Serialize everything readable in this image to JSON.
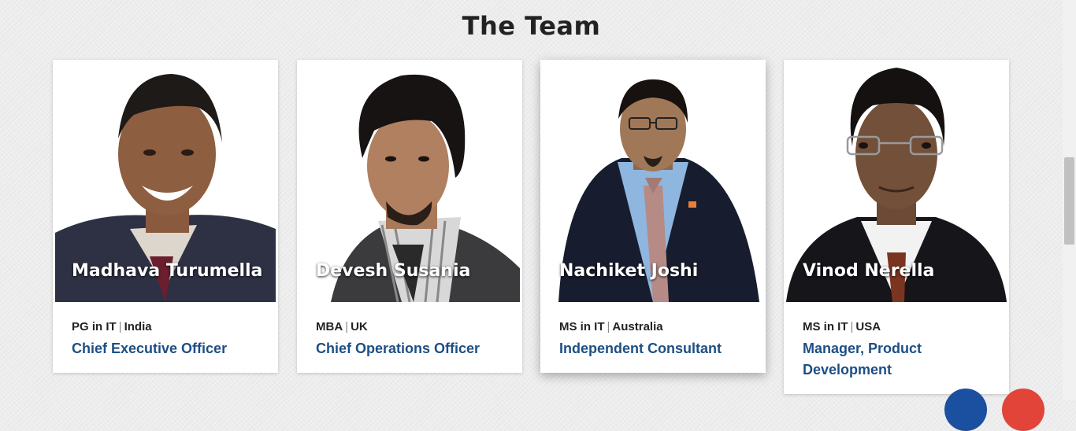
{
  "section": {
    "title": "The Team"
  },
  "members": [
    {
      "name": "Madhava Turumella",
      "degree": "PG in IT",
      "separator": "|",
      "location": "India",
      "role": "Chief Executive Officer"
    },
    {
      "name": "Devesh Susania",
      "degree": "MBA",
      "separator": "|",
      "location": "UK",
      "role": "Chief Operations Officer"
    },
    {
      "name": "Nachiket Joshi",
      "degree": "MS in IT",
      "separator": "|",
      "location": "Australia",
      "role": "Independent Consultant"
    },
    {
      "name": "Vinod Nerella",
      "degree": "MS in IT",
      "separator": "|",
      "location": "USA",
      "role": "Manager, Product Development"
    }
  ],
  "colors": {
    "role_text": "#1d4f85",
    "fab_blue": "#1b4fa0",
    "fab_red": "#e2443a"
  }
}
